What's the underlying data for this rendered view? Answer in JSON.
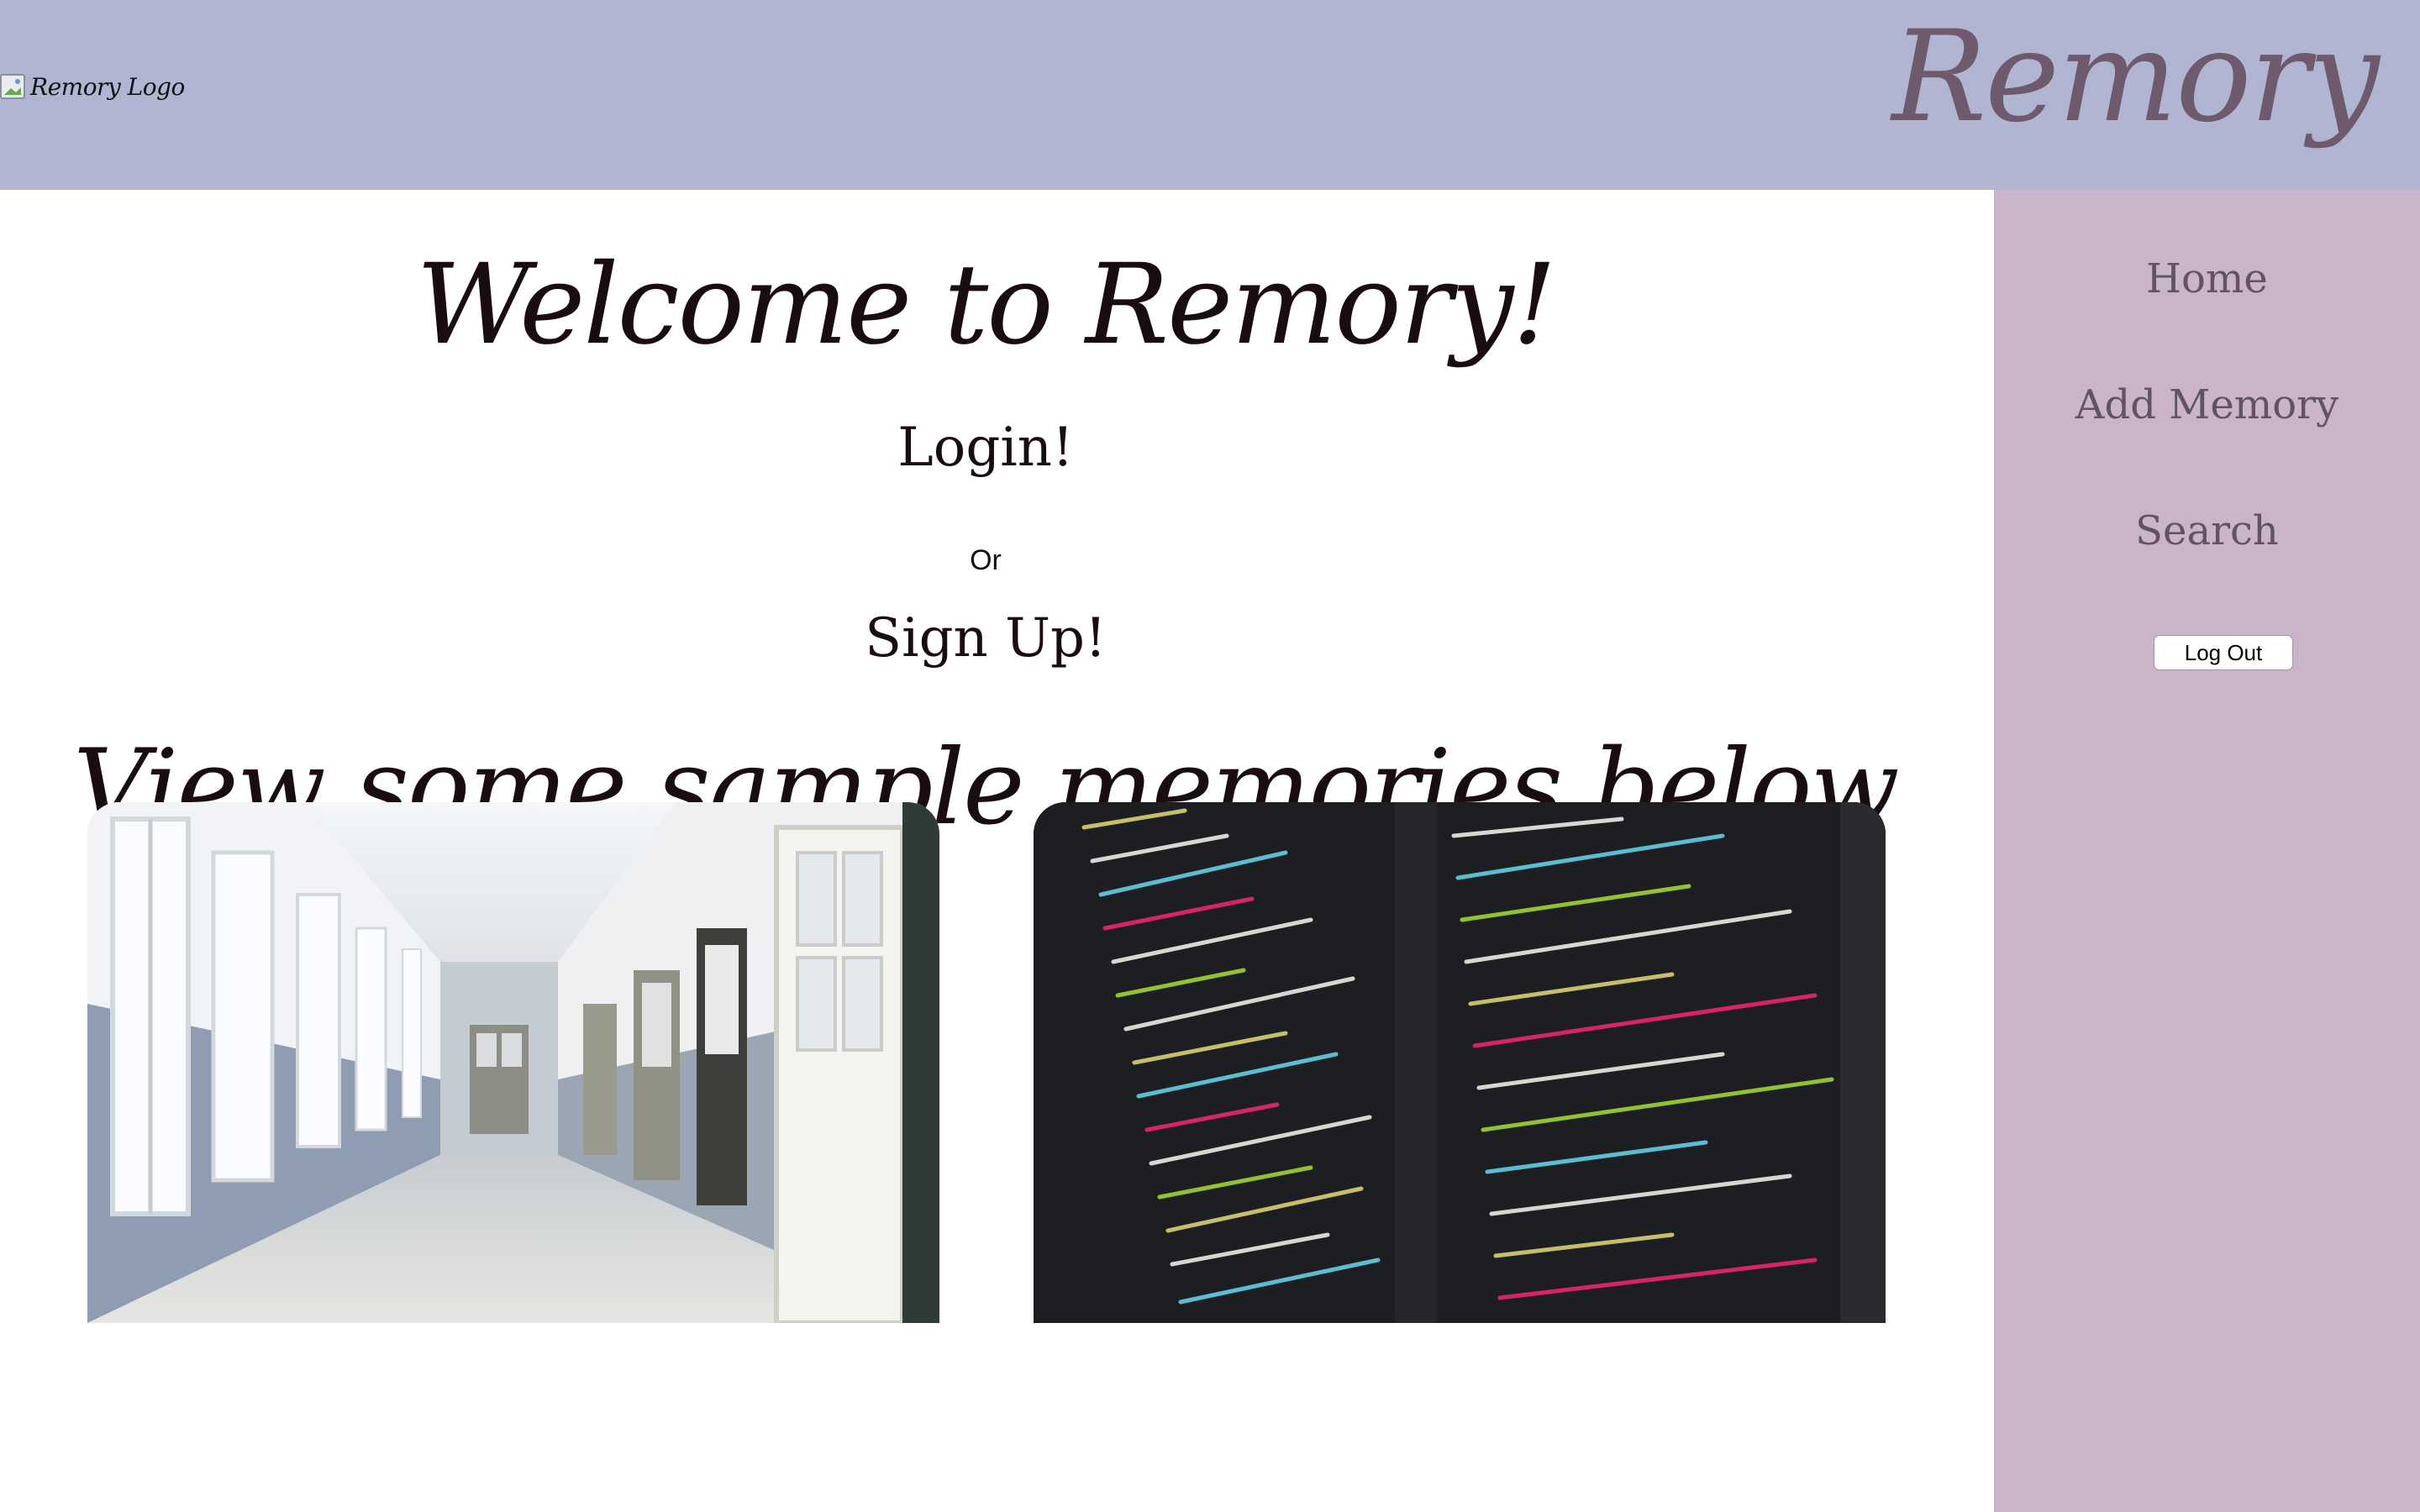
{
  "header": {
    "logo_alt": "Remory Logo",
    "brand": "Remory"
  },
  "main": {
    "welcome": "Welcome to Remory!",
    "login_label": "Login!",
    "or_text": "Or",
    "signup_label": "Sign Up!",
    "sample_heading": "View some sample memories below"
  },
  "sidebar": {
    "items": [
      {
        "label": "Home"
      },
      {
        "label": "Add Memory"
      },
      {
        "label": "Search"
      }
    ],
    "logout_label": "Log Out"
  },
  "memories": [
    {
      "subject": "school hallway with open doors and windows"
    },
    {
      "subject": "dark code editor with colorful syntax"
    }
  ],
  "colors": {
    "header_bg": "#b0b6d1",
    "sidebar_bg": "#c9b4c9",
    "brand_text": "#6e5a6c",
    "nav_text": "#5e5561"
  }
}
